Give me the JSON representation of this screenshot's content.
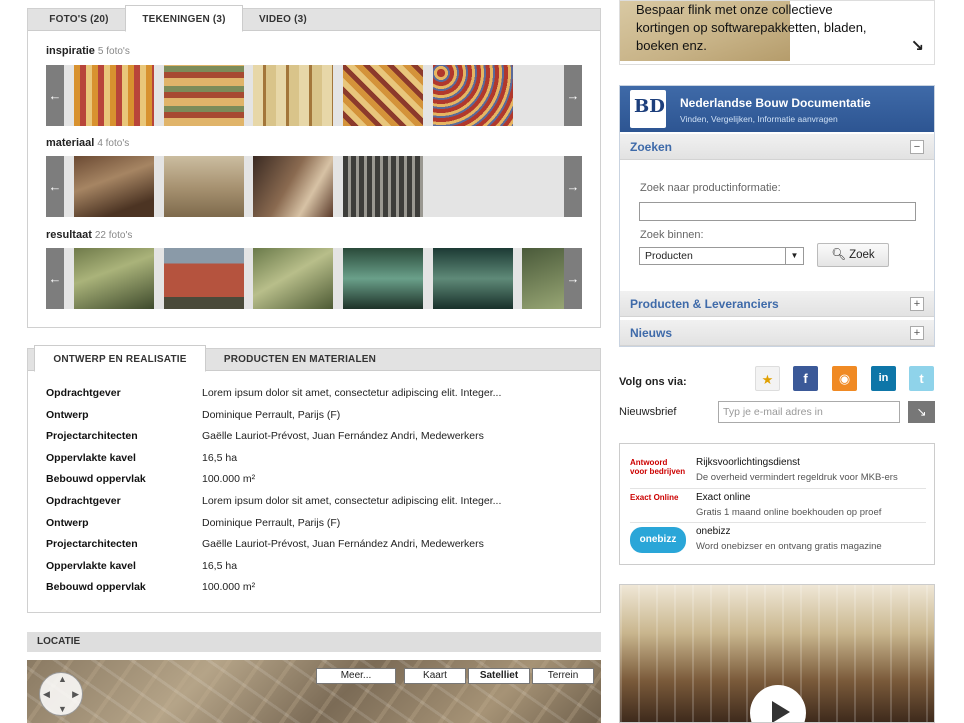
{
  "media_tabs": [
    {
      "label": "FOTO'S (20)"
    },
    {
      "label": "TEKENINGEN (3)"
    },
    {
      "label": "VIDEO (3)"
    }
  ],
  "galleries": [
    {
      "title": "inspiratie",
      "count": "5 foto's"
    },
    {
      "title": "materiaal",
      "count": "4 foto's"
    },
    {
      "title": "resultaat",
      "count": "22 foto's"
    }
  ],
  "detail_tabs": [
    {
      "label": "ONTWERP EN REALISATIE"
    },
    {
      "label": "PRODUCTEN EN MATERIALEN"
    }
  ],
  "details": [
    {
      "key": "Opdrachtgever",
      "value": "Lorem ipsum dolor sit amet, consectetur adipiscing elit. Integer..."
    },
    {
      "key": "Ontwerp",
      "value": "Dominique Perrault, Parijs (F)"
    },
    {
      "key": "Projectarchitecten",
      "value": "Gaëlle Lauriot-Prévost, Juan Fernández Andri, Medewerkers"
    },
    {
      "key": "Oppervlakte kavel",
      "value": "16,5 ha"
    },
    {
      "key": "Bebouwd oppervlak",
      "value": "100.000 m²"
    },
    {
      "key": "Opdrachtgever",
      "value": "Lorem ipsum dolor sit amet, consectetur adipiscing elit. Integer..."
    },
    {
      "key": "Ontwerp",
      "value": "Dominique Perrault, Parijs (F)"
    },
    {
      "key": "Projectarchitecten",
      "value": "Gaëlle Lauriot-Prévost, Juan Fernández Andri, Medewerkers"
    },
    {
      "key": "Oppervlakte kavel",
      "value": "16,5 ha"
    },
    {
      "key": "Bebouwd oppervlak",
      "value": "100.000 m²"
    }
  ],
  "location": {
    "title": "LOCATIE",
    "map_buttons": [
      "Meer...",
      "Kaart",
      "Satelliet",
      "Terrein"
    ]
  },
  "promo": {
    "text": "Bespaar flink met onze collectieve kortingen op softwarepakketten, bladen, boeken enz."
  },
  "nbd": {
    "name": "Nederlandse Bouw Documentatie",
    "subtitle": "Vinden, Vergelijken, Informatie aanvragen",
    "section_search": "Zoeken",
    "search_label": "Zoek naar productinformatie:",
    "within_label": "Zoek binnen:",
    "within_value": "Producten",
    "search_button": "Zoek",
    "section_products": "Producten & Leveranciers",
    "section_news": "Nieuws"
  },
  "follow": {
    "label": "Volg ons via:",
    "newsletter_label": "Nieuwsbrief",
    "email_placeholder": "Typ je e-mail adres in"
  },
  "sponsors": [
    {
      "logo": "Antwoord voor bedrijven",
      "title": "Rijksvoorlichtingsdienst",
      "desc": "De overheid vermindert regeldruk voor MKB-ers"
    },
    {
      "logo": "Exact Online",
      "title": "Exact online",
      "desc": "Gratis 1 maand online boekhouden op proef"
    },
    {
      "logo": "onebizz",
      "title": "onebizz",
      "desc": "Word onebizser en ontvang gratis magazine"
    }
  ],
  "colors": {
    "nbd_blue": "#2d5592",
    "link_blue": "#3e6aa9",
    "facebook": "#3b5998",
    "rss": "#f08a24",
    "linkedin": "#0e76a8",
    "twitter": "#8fd3ea"
  }
}
